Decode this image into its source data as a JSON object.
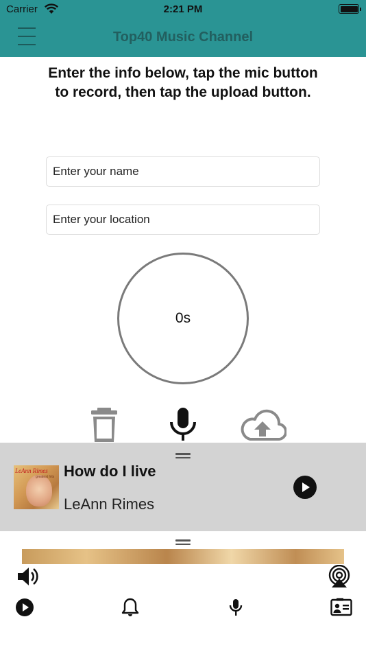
{
  "status_bar": {
    "carrier": "Carrier",
    "time": "2:21 PM"
  },
  "nav": {
    "title": "Top40 Music Channel",
    "menu_icon": "hamburger-icon"
  },
  "instructions": "Enter the info below, tap the mic button to record, then tap the upload button.",
  "form": {
    "name_placeholder": "Enter your name",
    "location_placeholder": "Enter your location"
  },
  "recorder": {
    "elapsed": "0s",
    "actions": [
      "trash-icon",
      "microphone-icon",
      "cloud-upload-icon"
    ]
  },
  "now_playing": {
    "title": "How do I live",
    "artist": "LeAnn Rimes",
    "album_art_text": "LeAnn Rimes",
    "album_art_subtext": "greatest hits"
  },
  "controls": {
    "left_icon": "volume-icon",
    "right_icon": "airplay-icon"
  },
  "tabs": [
    {
      "icon": "play-icon"
    },
    {
      "icon": "bell-icon"
    },
    {
      "icon": "microphone-icon"
    },
    {
      "icon": "contact-card-icon"
    }
  ],
  "colors": {
    "header": "#2a9494",
    "title": "#225f5f",
    "player_background": "#d3d3d3"
  }
}
